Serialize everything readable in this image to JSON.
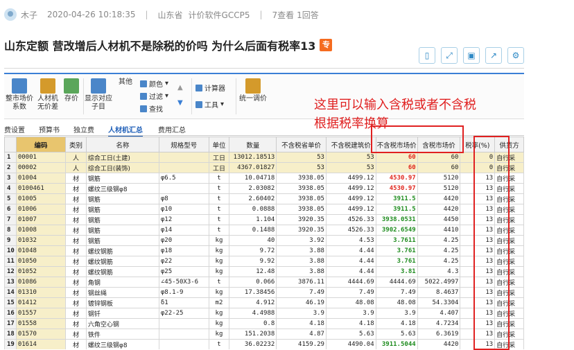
{
  "meta": {
    "author": "木子",
    "datetime": "2020-04-26 10:18:35",
    "location": "山东省",
    "software": "计价软件GCCP5",
    "views": "7查看",
    "answers": "1回答"
  },
  "title": "山东定额 营改增后人材机不是除税的价吗 为什么后面有税率13",
  "title_badge": "专",
  "ribbon": {
    "buttons": [
      {
        "label1": "整市场价",
        "label2": "系数"
      },
      {
        "label1": "人材机",
        "label2": "无价差"
      },
      {
        "label1": "存价",
        "label2": ""
      },
      {
        "label1": "显示对应",
        "label2": "子目"
      },
      {
        "label1": "其他",
        "label2": ""
      },
      {
        "label1": "统一调价",
        "label2": ""
      }
    ],
    "small": {
      "color": "颜色",
      "filter": "过滤",
      "find": "查找",
      "calculator": "计算器",
      "tools": "工具"
    }
  },
  "sub_tabs": [
    "费设置",
    "预算书",
    "独立费",
    "人材机汇总",
    "费用汇总"
  ],
  "table": {
    "headers": [
      "",
      "编码",
      "类别",
      "名称",
      "规格型号",
      "单位",
      "数量",
      "不含税省单价",
      "不含税建筑价",
      "不含税市场价",
      "含税市场价",
      "税率(%)",
      "供货方"
    ],
    "rows": [
      [
        "1",
        "00001",
        "人",
        "综合工日(土建)",
        "",
        "工日",
        "13012.18513",
        "53",
        "53",
        "60",
        "60",
        "0",
        "自行采"
      ],
      [
        "2",
        "00002",
        "人",
        "综合工日(装饰)",
        "",
        "工日",
        "4367.01827",
        "53",
        "53",
        "60",
        "60",
        "0",
        "自行采"
      ],
      [
        "3",
        "01004",
        "材",
        "钢筋",
        "φ6.5",
        "t",
        "10.04718",
        "3938.05",
        "4499.12",
        "4530.97",
        "5120",
        "13",
        "自行采"
      ],
      [
        "4",
        "0100461",
        "材",
        "螺纹三级钢φ8",
        "",
        "t",
        "2.03082",
        "3938.05",
        "4499.12",
        "4530.97",
        "5120",
        "13",
        "自行采"
      ],
      [
        "5",
        "01005",
        "材",
        "钢筋",
        "φ8",
        "t",
        "2.60402",
        "3938.05",
        "4499.12",
        "3911.5",
        "4420",
        "13",
        "自行采"
      ],
      [
        "6",
        "01006",
        "材",
        "钢筋",
        "φ10",
        "t",
        "0.0888",
        "3938.05",
        "4499.12",
        "3911.5",
        "4420",
        "13",
        "自行采"
      ],
      [
        "7",
        "01007",
        "材",
        "钢筋",
        "φ12",
        "t",
        "1.104",
        "3920.35",
        "4526.33",
        "3938.0531",
        "4450",
        "13",
        "自行采"
      ],
      [
        "8",
        "01008",
        "材",
        "钢筋",
        "φ14",
        "t",
        "0.1488",
        "3920.35",
        "4526.33",
        "3902.6549",
        "4410",
        "13",
        "自行采"
      ],
      [
        "9",
        "01032",
        "材",
        "钢筋",
        "φ20",
        "kg",
        "40",
        "3.92",
        "4.53",
        "3.7611",
        "4.25",
        "13",
        "自行采"
      ],
      [
        "10",
        "01048",
        "材",
        "螺纹钢筋",
        "φ18",
        "kg",
        "9.72",
        "3.88",
        "4.44",
        "3.761",
        "4.25",
        "13",
        "自行采"
      ],
      [
        "11",
        "01050",
        "材",
        "螺纹钢筋",
        "φ22",
        "kg",
        "9.92",
        "3.88",
        "4.44",
        "3.761",
        "4.25",
        "13",
        "自行采"
      ],
      [
        "12",
        "01052",
        "材",
        "螺纹钢筋",
        "φ25",
        "kg",
        "12.48",
        "3.88",
        "4.44",
        "3.81",
        "4.3",
        "13",
        "自行采"
      ],
      [
        "13",
        "01086",
        "材",
        "角钢",
        "∠45-50X3-6",
        "t",
        "0.066",
        "3876.11",
        "4444.69",
        "4444.69",
        "5022.4997",
        "13",
        "自行采"
      ],
      [
        "14",
        "01310",
        "材",
        "钢丝绳",
        "φ8.1-9",
        "kg",
        "17.38456",
        "7.49",
        "7.49",
        "7.49",
        "8.4637",
        "13",
        "自行采"
      ],
      [
        "15",
        "01412",
        "材",
        "镀锌钢板",
        "δ1",
        "m2",
        "4.912",
        "46.19",
        "48.08",
        "48.08",
        "54.3304",
        "13",
        "自行采"
      ],
      [
        "16",
        "01557",
        "材",
        "钢钎",
        "φ22-25",
        "kg",
        "4.4988",
        "3.9",
        "3.9",
        "3.9",
        "4.407",
        "13",
        "自行采"
      ],
      [
        "17",
        "01558",
        "材",
        "六角空心钢",
        "",
        "kg",
        "0.8",
        "4.18",
        "4.18",
        "4.18",
        "4.7234",
        "13",
        "自行采"
      ],
      [
        "18",
        "01570",
        "材",
        "铁件",
        "",
        "kg",
        "151.2038",
        "4.87",
        "5.63",
        "5.63",
        "6.3619",
        "13",
        "自行采"
      ],
      [
        "19",
        "01614",
        "材",
        "螺纹三级钢φ8",
        "",
        "t",
        "36.02232",
        "4159.29",
        "4490.04",
        "3911.5044",
        "4420",
        "13",
        "自行采"
      ]
    ],
    "market_price_color": {
      "1": "red",
      "2": "red",
      "3": "red",
      "4": "red",
      "5": "green",
      "6": "green",
      "7": "green",
      "8": "green",
      "9": "green",
      "10": "green",
      "11": "green",
      "12": "green",
      "19": "green"
    }
  },
  "annotation": {
    "line1": "这里可以输入含税或者不含税",
    "line2": "根据税率换算"
  },
  "colors": {
    "annotation": "#e02020",
    "market_red": "#e0281f",
    "market_green": "#1f8c1f",
    "accent": "#2f8ac6",
    "badge": "#f56b1f"
  }
}
